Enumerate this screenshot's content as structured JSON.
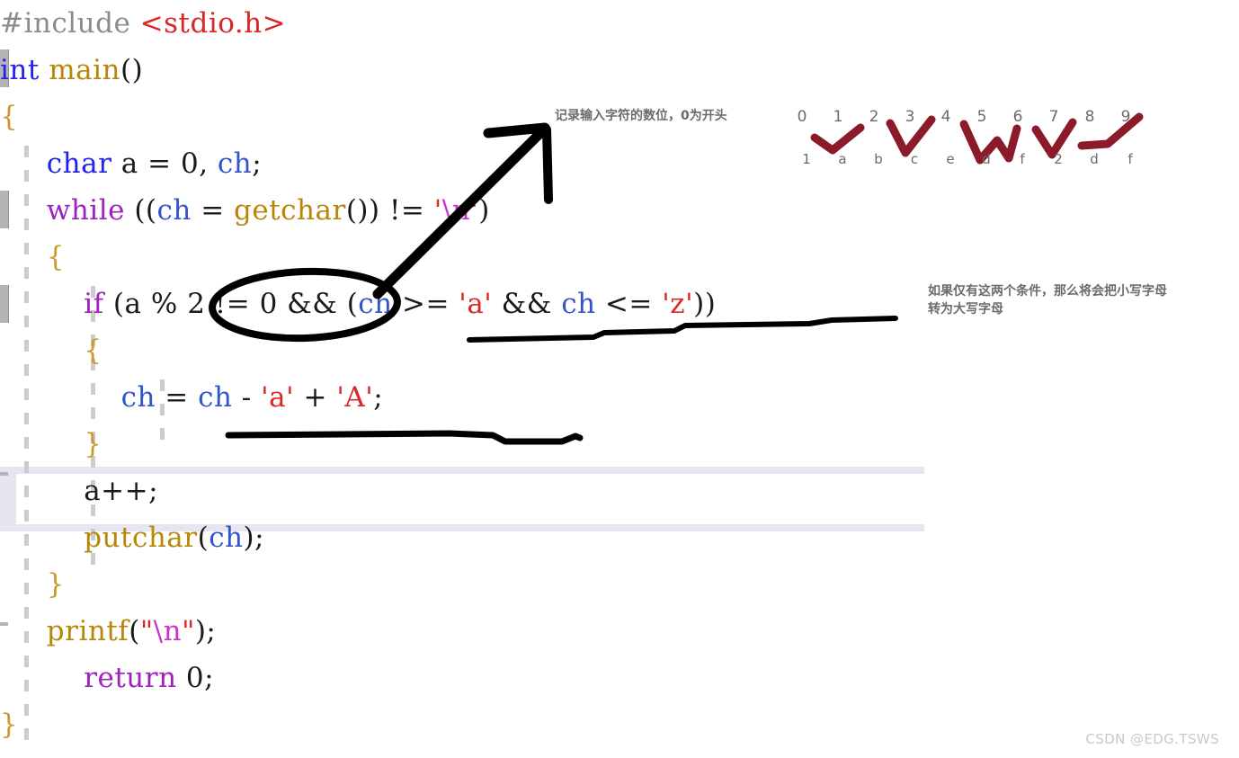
{
  "watermark": "CSDN @EDG.TSWS",
  "code": {
    "language": "C",
    "lines": [
      {
        "indent": 0,
        "tokens": [
          {
            "t": "#include ",
            "c": "pre"
          },
          {
            "t": "<stdio.h>",
            "c": "inc"
          }
        ]
      },
      {
        "indent": 0,
        "tokens": [
          {
            "t": "int",
            "c": "kw"
          },
          {
            "t": " ",
            "c": "plain"
          },
          {
            "t": "main",
            "c": "fn"
          },
          {
            "t": "()",
            "c": "plain"
          }
        ]
      },
      {
        "indent": 0,
        "tokens": [
          {
            "t": "{",
            "c": "brace"
          }
        ]
      },
      {
        "indent": 1,
        "tokens": [
          {
            "t": "char",
            "c": "kw"
          },
          {
            "t": " a = ",
            "c": "plain"
          },
          {
            "t": "0",
            "c": "plain"
          },
          {
            "t": ", ",
            "c": "plain"
          },
          {
            "t": "ch",
            "c": "var"
          },
          {
            "t": ";",
            "c": "plain"
          }
        ]
      },
      {
        "indent": 1,
        "tokens": [
          {
            "t": "while",
            "c": "kw2"
          },
          {
            "t": " ((",
            "c": "plain"
          },
          {
            "t": "ch",
            "c": "var"
          },
          {
            "t": " = ",
            "c": "plain"
          },
          {
            "t": "getchar",
            "c": "fn"
          },
          {
            "t": "()) != ",
            "c": "plain"
          },
          {
            "t": "'",
            "c": "str"
          },
          {
            "t": "\\n",
            "c": "esc"
          },
          {
            "t": "'",
            "c": "str"
          },
          {
            "t": ")",
            "c": "plain"
          }
        ]
      },
      {
        "indent": 1,
        "tokens": [
          {
            "t": "{",
            "c": "brace"
          }
        ]
      },
      {
        "indent": 2,
        "tokens": [
          {
            "t": "if",
            "c": "kw2"
          },
          {
            "t": " (a % ",
            "c": "plain"
          },
          {
            "t": "2",
            "c": "plain"
          },
          {
            "t": " != ",
            "c": "plain"
          },
          {
            "t": "0",
            "c": "plain"
          },
          {
            "t": " && (",
            "c": "plain"
          },
          {
            "t": "ch",
            "c": "var"
          },
          {
            "t": " >= ",
            "c": "plain"
          },
          {
            "t": "'a'",
            "c": "str"
          },
          {
            "t": " && ",
            "c": "plain"
          },
          {
            "t": "ch",
            "c": "var"
          },
          {
            "t": " <= ",
            "c": "plain"
          },
          {
            "t": "'z'",
            "c": "str"
          },
          {
            "t": "))",
            "c": "plain"
          }
        ]
      },
      {
        "indent": 2,
        "tokens": [
          {
            "t": "{",
            "c": "brace"
          }
        ]
      },
      {
        "indent": 3,
        "tokens": [
          {
            "t": "ch",
            "c": "var"
          },
          {
            "t": " = ",
            "c": "plain"
          },
          {
            "t": "ch",
            "c": "var"
          },
          {
            "t": " - ",
            "c": "plain"
          },
          {
            "t": "'a'",
            "c": "str"
          },
          {
            "t": " + ",
            "c": "plain"
          },
          {
            "t": "'A'",
            "c": "str"
          },
          {
            "t": ";",
            "c": "plain"
          }
        ]
      },
      {
        "indent": 2,
        "tokens": [
          {
            "t": "}",
            "c": "brace"
          }
        ]
      },
      {
        "indent": 2,
        "tokens": [
          {
            "t": "a++;",
            "c": "plain"
          }
        ]
      },
      {
        "indent": 2,
        "tokens": [
          {
            "t": "putchar",
            "c": "fn"
          },
          {
            "t": "(",
            "c": "plain"
          },
          {
            "t": "ch",
            "c": "var"
          },
          {
            "t": ");",
            "c": "plain"
          }
        ]
      },
      {
        "indent": 1,
        "tokens": [
          {
            "t": "}",
            "c": "brace"
          }
        ]
      },
      {
        "indent": 1,
        "tokens": [
          {
            "t": "printf",
            "c": "fn"
          },
          {
            "t": "(",
            "c": "plain"
          },
          {
            "t": "\"",
            "c": "str"
          },
          {
            "t": "\\n",
            "c": "esc"
          },
          {
            "t": "\"",
            "c": "str"
          },
          {
            "t": ");",
            "c": "plain"
          }
        ]
      },
      {
        "indent": 2,
        "tokens": [
          {
            "t": "return",
            "c": "kw2"
          },
          {
            "t": " ",
            "c": "plain"
          },
          {
            "t": "0",
            "c": "plain"
          },
          {
            "t": ";",
            "c": "plain"
          }
        ]
      },
      {
        "indent": 0,
        "tokens": [
          {
            "t": "}",
            "c": "brace"
          }
        ]
      }
    ],
    "highlighted_line": "a++;",
    "colors": {
      "preprocessor": "#8c8c8c",
      "include_path": "#d82828",
      "keyword_type": "#2222ee",
      "keyword_control": "#a020c0",
      "function": "#b8860b",
      "variable": "#3355cc",
      "string": "#d82828",
      "escape": "#cc33cc",
      "brace": "#c99a2e",
      "plain": "#1a1a1a",
      "background": "#ffffff",
      "line_highlight": "#e6e6f2"
    }
  },
  "annotations": {
    "ink_color_black": "#000000",
    "ink_color_red": "#8b1a2b",
    "note_count": "记录输入字符的数位，0为开头",
    "note_condition_line1": "如果仅有这两个条件，那么将会把小写字母",
    "note_condition_line2": "转为大写字母",
    "sequence_digits": [
      "0",
      "1",
      "2",
      "3",
      "4",
      "5",
      "6",
      "7",
      "8",
      "9"
    ],
    "sequence_letters": [
      "1",
      "a",
      "b",
      "c",
      "e",
      "d",
      "f",
      "2",
      "d",
      "f"
    ],
    "ellipse_target": "a % 2 != 0",
    "underline_targets": [
      "(ch >= 'a' && ch <= 'z'))",
      "ch = ch - 'a' + 'A';"
    ]
  }
}
